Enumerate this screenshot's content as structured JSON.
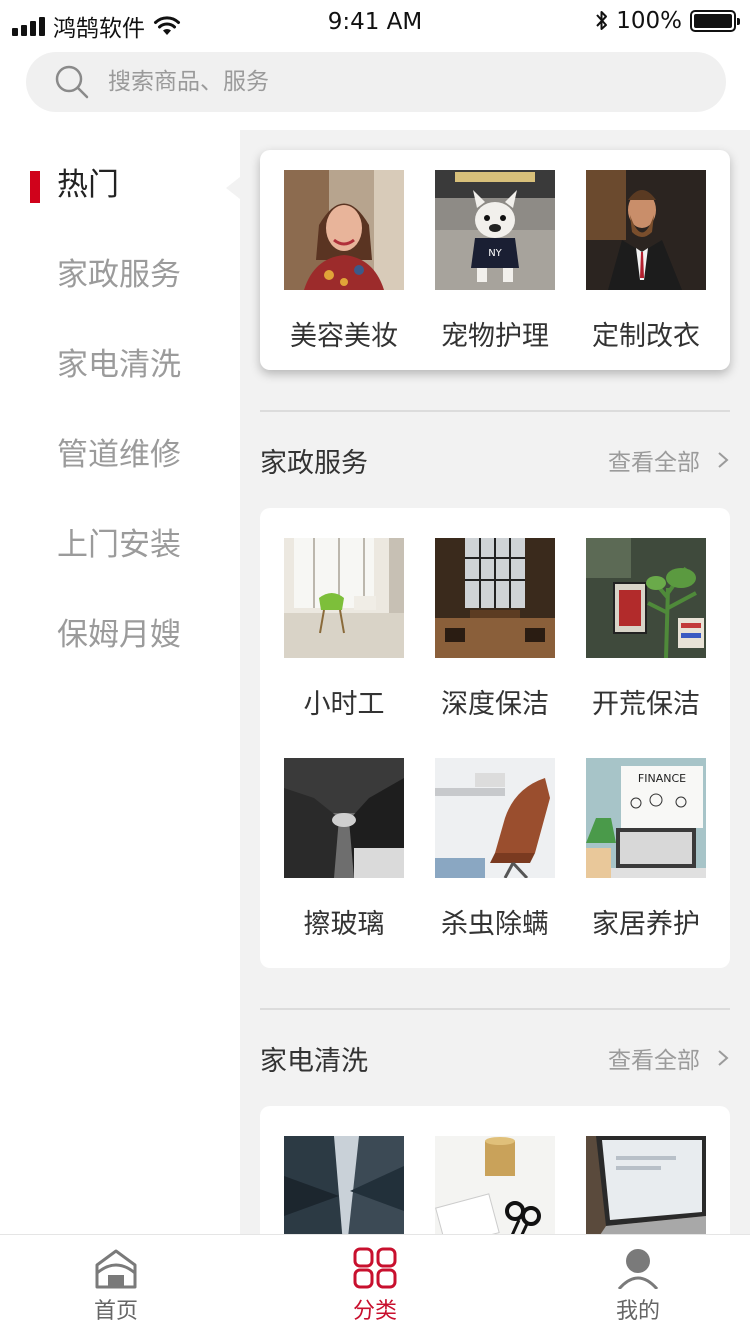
{
  "status_bar": {
    "carrier": "鸿鹄软件",
    "time": "9:41 AM",
    "battery": "100%"
  },
  "search": {
    "placeholder": "搜索商品、服务"
  },
  "sidebar": {
    "items": [
      {
        "label": "热门",
        "active": true
      },
      {
        "label": "家政服务",
        "active": false
      },
      {
        "label": "家电清洗",
        "active": false
      },
      {
        "label": "管道维修",
        "active": false
      },
      {
        "label": "上门安装",
        "active": false
      },
      {
        "label": "保姆月嫂",
        "active": false
      }
    ]
  },
  "hot": {
    "items": [
      {
        "label": "美容美妆",
        "icon": "portrait-woman-photo"
      },
      {
        "label": "宠物护理",
        "icon": "bulldog-photo"
      },
      {
        "label": "定制改衣",
        "icon": "bearded-man-suit-photo"
      }
    ]
  },
  "sections": [
    {
      "title": "家政服务",
      "view_all": "查看全部",
      "items": [
        {
          "label": "小时工",
          "icon": "bright-room-chairs-photo"
        },
        {
          "label": "深度保洁",
          "icon": "cafe-window-photo"
        },
        {
          "label": "开荒保洁",
          "icon": "plants-shelf-photo"
        },
        {
          "label": "擦玻璃",
          "icon": "handshake-photo"
        },
        {
          "label": "杀虫除螨",
          "icon": "office-chair-photo"
        },
        {
          "label": "家居养护",
          "icon": "finance-laptop-photo"
        }
      ]
    },
    {
      "title": "家电清洗",
      "view_all": "查看全部",
      "items": [
        {
          "label": "",
          "icon": "glass-building-photo"
        },
        {
          "label": "",
          "icon": "scissors-desk-photo"
        },
        {
          "label": "",
          "icon": "laptop-photo"
        }
      ]
    }
  ],
  "tabbar": {
    "items": [
      {
        "label": "首页",
        "icon": "home-icon",
        "active": false
      },
      {
        "label": "分类",
        "icon": "grid-icon",
        "active": true
      },
      {
        "label": "我的",
        "icon": "user-icon",
        "active": false
      }
    ]
  },
  "colors": {
    "accent": "#d0021b",
    "tab_active": "#c8102e",
    "content_bg": "#f2f2f2"
  }
}
